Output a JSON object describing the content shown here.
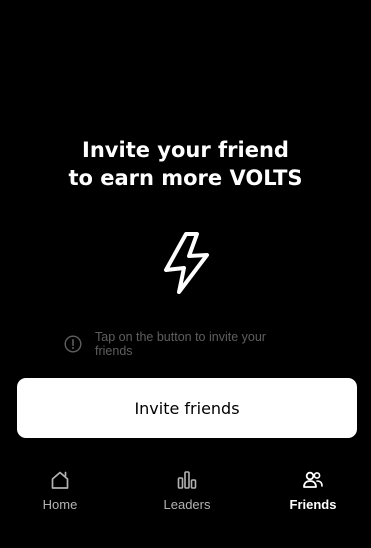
{
  "headline": {
    "line1": "Invite your friend",
    "line2": "to earn more VOLTS"
  },
  "hero_icon": "lightning-bolt",
  "hint": {
    "icon": "info-circle",
    "text": "Tap on the button to invite your friends"
  },
  "invite_button": {
    "label": "Invite friends"
  },
  "tab_bar": {
    "active": "Friends",
    "tabs": [
      {
        "label": "Home",
        "icon": "home-icon"
      },
      {
        "label": "Leaders",
        "icon": "bar-chart-icon"
      },
      {
        "label": "Friends",
        "icon": "friends-icon"
      }
    ]
  },
  "colors": {
    "background": "#000000",
    "primary_text": "#ffffff",
    "muted_text": "#5f5f5f",
    "inactive_tab": "#b3b3b3",
    "button_bg": "#ffffff",
    "button_text": "#000000"
  }
}
